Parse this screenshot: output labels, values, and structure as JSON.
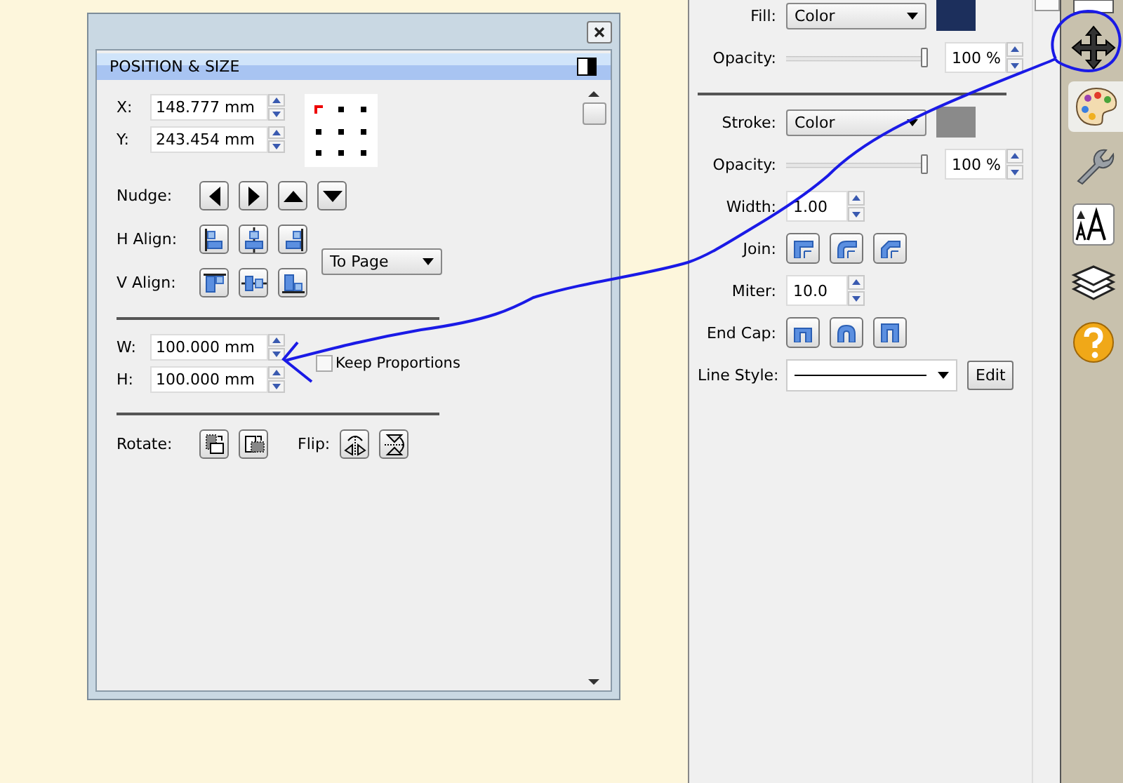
{
  "dialog": {
    "header": "POSITION & SIZE",
    "position_fields": [
      {
        "label": "X:",
        "value": "148.777 mm"
      },
      {
        "label": "Y:",
        "value": "243.454 mm"
      }
    ],
    "anchors": [
      {
        "selected": true
      },
      {
        "selected": false
      },
      {
        "selected": false
      },
      {
        "selected": false
      },
      {
        "selected": false
      },
      {
        "selected": false
      },
      {
        "selected": false
      },
      {
        "selected": false
      },
      {
        "selected": false
      }
    ],
    "nudge": {
      "label": "Nudge:",
      "buttons": [
        {
          "kind": "left"
        },
        {
          "kind": "right"
        },
        {
          "kind": "up"
        },
        {
          "kind": "down"
        }
      ]
    },
    "h_align": {
      "label": "H Align:",
      "buttons": [
        {
          "kind": "left"
        },
        {
          "kind": "center"
        },
        {
          "kind": "right"
        }
      ]
    },
    "v_align": {
      "label": "V Align:",
      "buttons": [
        {
          "kind": "top"
        },
        {
          "kind": "middle"
        },
        {
          "kind": "bottom"
        }
      ]
    },
    "align_to": "To Page",
    "size_fields": [
      {
        "label": "W:",
        "value": "100.000 mm"
      },
      {
        "label": "H:",
        "value": "100.000 mm"
      }
    ],
    "keep_proportions": {
      "label": "Keep Proportions",
      "checked": false
    },
    "rotate": {
      "label": "Rotate:"
    },
    "flip": {
      "label": "Flip:"
    }
  },
  "properties": {
    "fill": {
      "label": "Fill:",
      "value": "Color",
      "color": "#1c2f5c"
    },
    "fill_opacity": {
      "label": "Opacity:",
      "level": 1,
      "reading": "100 %"
    },
    "stroke": {
      "label": "Stroke:",
      "value": "Color",
      "color": "#8a8a8a"
    },
    "stroke_opacity": {
      "label": "Opacity:",
      "level": 1,
      "reading": "100 %"
    },
    "width": {
      "label": "Width:",
      "value": "1.00"
    },
    "join": {
      "label": "Join:",
      "buttons": [
        {
          "kind": "miter"
        },
        {
          "kind": "round"
        },
        {
          "kind": "bevel"
        }
      ]
    },
    "miter": {
      "label": "Miter:",
      "value": "10.0"
    },
    "end_cap": {
      "label": "End Cap:",
      "buttons": [
        {
          "kind": "butt"
        },
        {
          "kind": "round"
        },
        {
          "kind": "square"
        }
      ]
    },
    "line_style": {
      "label": "Line Style:",
      "edit": "Edit"
    }
  },
  "side_tabs": [
    {
      "kind": "page",
      "selected": false
    },
    {
      "kind": "move",
      "selected": false
    },
    {
      "kind": "palette",
      "selected": true
    },
    {
      "kind": "wrench",
      "selected": false
    },
    {
      "kind": "text",
      "selected": false
    },
    {
      "kind": "layers",
      "selected": false
    },
    {
      "kind": "help",
      "selected": false
    }
  ]
}
